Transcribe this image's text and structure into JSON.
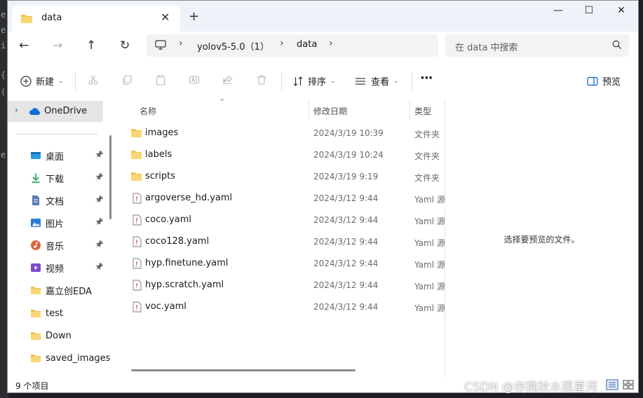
{
  "window": {
    "tab_title": "data",
    "new_tab": "+",
    "close_tab": "✕",
    "controls": {
      "minimize": "—",
      "maximize": "☐",
      "close": "✕"
    }
  },
  "nav": {
    "back": "←",
    "forward": "→",
    "up": "↑",
    "refresh": "↻"
  },
  "breadcrumbs": [
    "yolov5-5.0（1）",
    "data"
  ],
  "search": {
    "placeholder": "在 data 中搜索"
  },
  "toolbar": {
    "new_label": "新建",
    "sort_label": "排序",
    "view_label": "查看",
    "more_label": "···",
    "preview_label": "预览"
  },
  "sidebar": {
    "onedrive": "OneDrive",
    "items": [
      {
        "label": "桌面",
        "icon": "desktop-icon",
        "pinned": true,
        "color": "#2b9be0"
      },
      {
        "label": "下载",
        "icon": "download-icon",
        "pinned": true,
        "color": "#1f9d55"
      },
      {
        "label": "文档",
        "icon": "document-icon",
        "pinned": true,
        "color": "#5a7bb5"
      },
      {
        "label": "图片",
        "icon": "pictures-icon",
        "pinned": true,
        "color": "#2a7dd6"
      },
      {
        "label": "音乐",
        "icon": "music-icon",
        "pinned": true,
        "color": "#e0643a"
      },
      {
        "label": "视频",
        "icon": "video-icon",
        "pinned": true,
        "color": "#7a4cc9"
      },
      {
        "label": "嘉立创EDA",
        "icon": "folder-icon",
        "pinned": false,
        "color": "#f2c14e"
      },
      {
        "label": "test",
        "icon": "folder-icon",
        "pinned": false,
        "color": "#f2c14e"
      },
      {
        "label": "Down",
        "icon": "folder-icon",
        "pinned": false,
        "color": "#f2c14e"
      },
      {
        "label": "saved_images",
        "icon": "folder-icon",
        "pinned": false,
        "color": "#f2c14e"
      }
    ]
  },
  "columns": {
    "name": "名称",
    "date": "修改日期",
    "type": "类型"
  },
  "files": [
    {
      "name": "images",
      "date": "2024/3/19 10:39",
      "type": "文件夹",
      "kind": "folder"
    },
    {
      "name": "labels",
      "date": "2024/3/19 10:24",
      "type": "文件夹",
      "kind": "folder"
    },
    {
      "name": "scripts",
      "date": "2024/3/19 9:19",
      "type": "文件夹",
      "kind": "folder"
    },
    {
      "name": "argoverse_hd.yaml",
      "date": "2024/3/12 9:44",
      "type": "Yaml 源",
      "kind": "file"
    },
    {
      "name": "coco.yaml",
      "date": "2024/3/12 9:44",
      "type": "Yaml 源",
      "kind": "file"
    },
    {
      "name": "coco128.yaml",
      "date": "2024/3/12 9:44",
      "type": "Yaml 源",
      "kind": "file"
    },
    {
      "name": "hyp.finetune.yaml",
      "date": "2024/3/12 9:44",
      "type": "Yaml 源",
      "kind": "file"
    },
    {
      "name": "hyp.scratch.yaml",
      "date": "2024/3/12 9:44",
      "type": "Yaml 源",
      "kind": "file"
    },
    {
      "name": "voc.yaml",
      "date": "2024/3/12 9:44",
      "type": "Yaml 源",
      "kind": "file"
    }
  ],
  "preview": {
    "message": "选择要预览的文件。"
  },
  "status": {
    "count": "9 个项目"
  },
  "watermark": "CSDN @亦携秋水揽星河",
  "colors": {
    "accent": "#0067c0",
    "folder": "#f2c14e",
    "selected": "#e5e5e5",
    "titlebar": "#eef3f9"
  }
}
